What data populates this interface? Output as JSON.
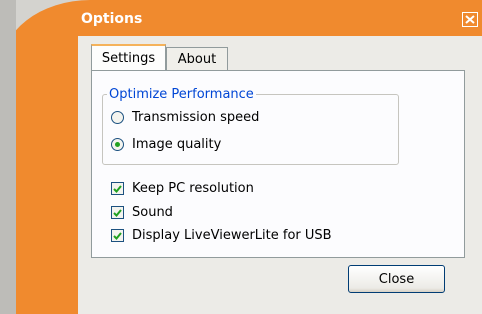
{
  "window": {
    "title": "Options"
  },
  "tabs": [
    {
      "label": "Settings",
      "selected": true
    },
    {
      "label": "About",
      "selected": false
    }
  ],
  "performance_group": {
    "title": "Optimize Performance",
    "options": [
      {
        "label": "Transmission speed",
        "selected": false
      },
      {
        "label": "Image quality",
        "selected": true
      }
    ]
  },
  "checkboxes": [
    {
      "label": "Keep PC resolution",
      "checked": true
    },
    {
      "label": "Sound",
      "checked": true
    },
    {
      "label": "Display LiveViewerLite for USB",
      "checked": true
    }
  ],
  "buttons": {
    "close_label": "Close"
  },
  "colors": {
    "accent_orange": "#f08a2e",
    "group_title_blue": "#0046d5",
    "check_green": "#21a121"
  }
}
